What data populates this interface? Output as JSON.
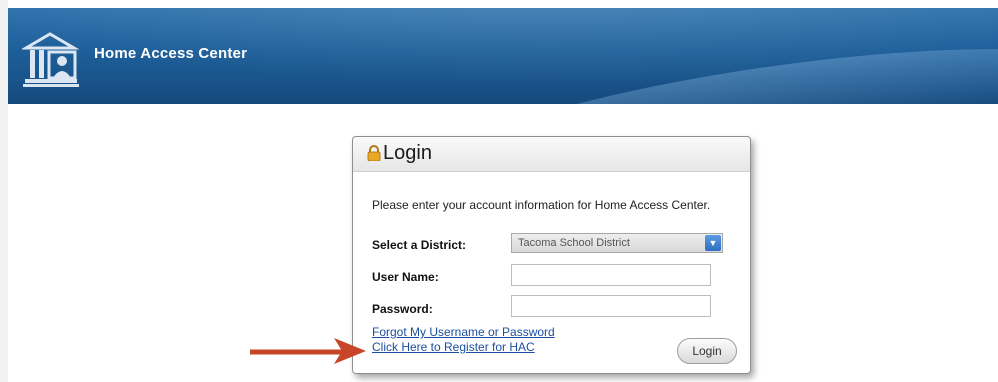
{
  "header": {
    "app_title": "Home Access Center",
    "logo_icon": "building-columns-person-icon",
    "background_color": "#1e5f9a"
  },
  "login": {
    "title": "Login",
    "lock_icon": "lock-icon",
    "intro_text": "Please enter your account information for Home Access Center.",
    "district_label": "Select a District:",
    "district_value": "Tacoma School District",
    "username_label": "User Name:",
    "username_value": "",
    "password_label": "Password:",
    "password_value": "",
    "forgot_link": "Forgot My Username or Password",
    "register_link": "Click Here to Register for HAC",
    "login_button": "Login",
    "link_color": "#1c4fa0"
  },
  "annotation": {
    "arrow_icon": "red-arrow-icon",
    "arrow_color": "#c8452a"
  }
}
